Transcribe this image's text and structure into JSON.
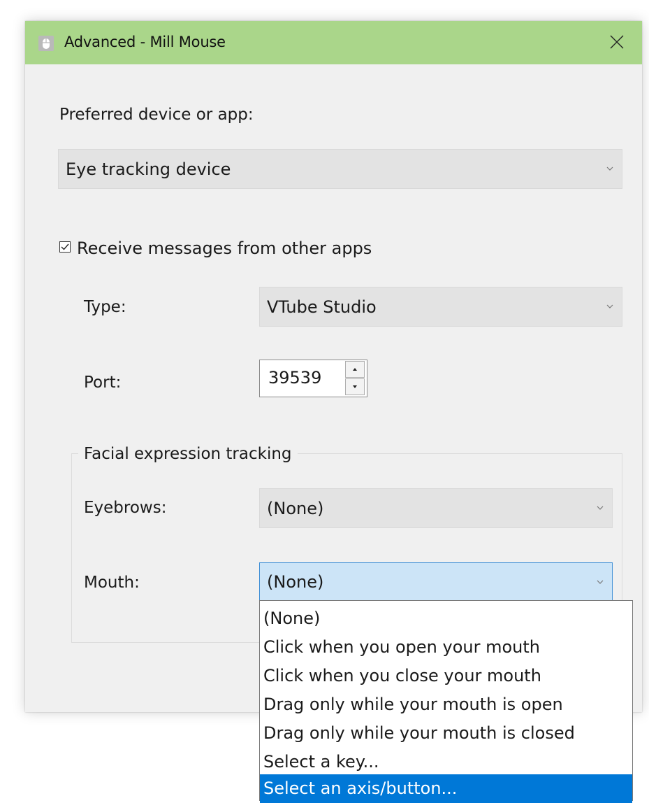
{
  "window": {
    "title": "Advanced - Mill Mouse",
    "app_icon": "mouse-icon",
    "close_icon": "close-icon"
  },
  "preferred": {
    "label": "Preferred device or app:",
    "value": "Eye tracking device"
  },
  "receive": {
    "label": "Receive messages from other apps",
    "checked": true
  },
  "type": {
    "label": "Type:",
    "value": "VTube Studio"
  },
  "port": {
    "label": "Port:",
    "value": "39539"
  },
  "facial": {
    "title": "Facial expression tracking",
    "eyebrows": {
      "label": "Eyebrows:",
      "value": "(None)"
    },
    "mouth": {
      "label": "Mouth:",
      "value": "(None)"
    }
  },
  "mouth_dropdown": {
    "options": [
      "(None)",
      "Click when you open your mouth",
      "Click when you close your mouth",
      "Drag only while your mouth is open",
      "Drag only while your mouth is closed",
      "Select a key...",
      "Select an axis/button..."
    ],
    "highlighted": "Select an axis/button..."
  },
  "colors": {
    "titlebar": "#aad68a",
    "highlight": "#0078d7",
    "focused_combo": "#cce4f7"
  }
}
